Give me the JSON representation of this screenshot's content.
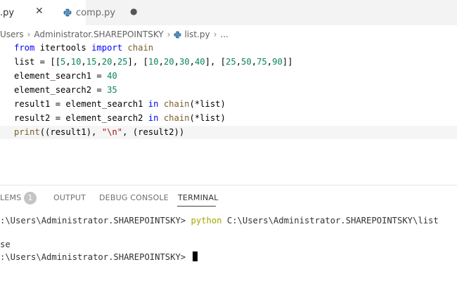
{
  "tabs": [
    {
      "label": ".py",
      "close_icon": "close-icon",
      "active": true
    },
    {
      "label": "comp.py",
      "icon": "python-file-icon",
      "modified_indicator": "●",
      "active": false
    }
  ],
  "breadcrumb": {
    "items": [
      "Users",
      "Administrator.SHAREPOINTSKY",
      "list.py",
      "..."
    ]
  },
  "code": {
    "lines": [
      "from itertools import chain",
      "list = [[5,10,15,20,25], [10,20,30,40], [25,50,75,90]]",
      "element_search1 = 40",
      "element_search2 = 35",
      "result1 = element_search1 in chain(*list)",
      "result2 = element_search2 in chain(*list)",
      "print((result1), \"\\n\", (result2))"
    ]
  },
  "panel": {
    "tabs": {
      "problems": "LEMS",
      "problems_count": "1",
      "output": "OUTPUT",
      "debug_console": "DEBUG CONSOLE",
      "terminal": "TERMINAL"
    },
    "terminal": {
      "prompt1": ":\\Users\\Administrator.SHAREPOINTSKY> ",
      "command": "python",
      "command_arg": " C:\\Users\\Administrator.SHAREPOINTSKY\\list",
      "output": "se",
      "prompt2": ":\\Users\\Administrator.SHAREPOINTSKY> "
    }
  },
  "colors": {
    "keyword": "#0000ff",
    "number": "#098658",
    "string": "#a31515",
    "command": "#a5a500",
    "tabbar": "#f3f3f3"
  }
}
